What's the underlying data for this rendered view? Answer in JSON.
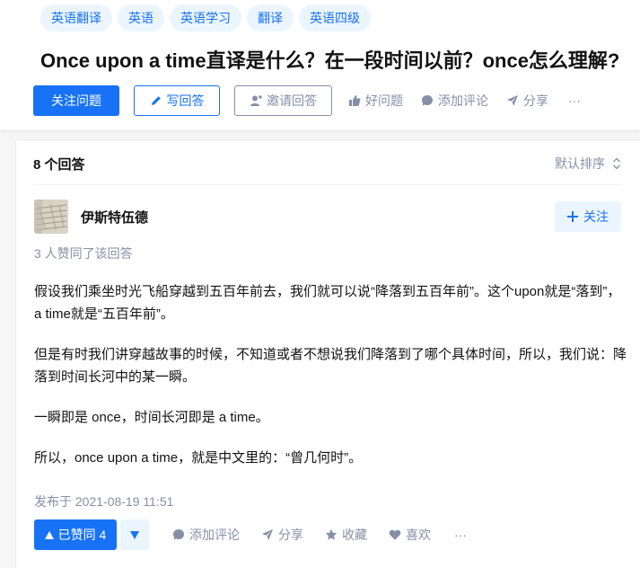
{
  "topics": [
    "英语翻译",
    "英语",
    "英语学习",
    "翻译",
    "英语四级"
  ],
  "question": {
    "title": "Once upon a time直译是什么？在一段时间以前？once怎么理解?"
  },
  "question_actions": {
    "follow": "关注问题",
    "write": "写回答",
    "invite": "邀请回答",
    "good_question": "好问题",
    "comment": "添加评论",
    "share": "分享",
    "more": "···"
  },
  "answers": {
    "count_label": "8 个回答",
    "sort_label": "默认排序"
  },
  "answer": {
    "author": "伊斯特伍德",
    "follow_label": "关注",
    "voters": "3 人赞同了该回答",
    "paragraphs": [
      "假设我们乘坐时光飞船穿越到五百年前去，我们就可以说“降落到五百年前”。这个upon就是“落到”，a time就是“五百年前”。",
      "但是有时我们讲穿越故事的时候，不知道或者不想说我们降落到了哪个具体时间，所以，我们说：降落到时间长河中的某一瞬。",
      "一瞬即是 once，时间长河即是 a time。",
      "所以，once upon a time，就是中文里的：“曾几何时”。"
    ],
    "published": "发布于 2021-08-19 11:51",
    "vote_label": "已赞同 4",
    "comment": "添加评论",
    "share": "分享",
    "collect": "收藏",
    "like": "喜欢",
    "more": "···"
  },
  "colors": {
    "brand": "#1772f6",
    "brand_light": "#ebf5ff",
    "muted": "#8590a6"
  }
}
